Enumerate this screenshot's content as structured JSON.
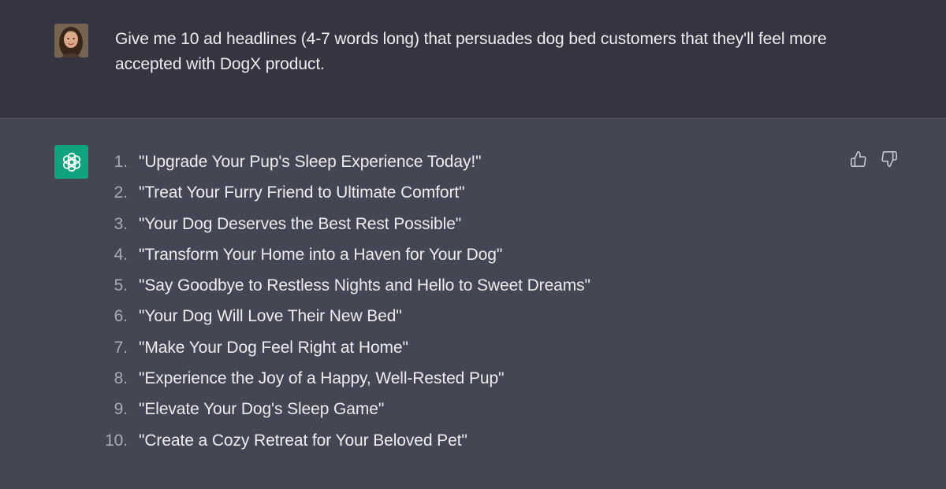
{
  "user": {
    "avatar_icon": "user-avatar",
    "message": "Give me 10 ad headlines (4-7 words long) that persuades dog bed customers that they'll feel more accepted with DogX product."
  },
  "assistant": {
    "logo_icon": "openai-logo-icon",
    "logo_color": "#10a37f",
    "headlines": [
      {
        "num": "1.",
        "text": "\"Upgrade Your Pup's Sleep Experience Today!\""
      },
      {
        "num": "2.",
        "text": "\"Treat Your Furry Friend to Ultimate Comfort\""
      },
      {
        "num": "3.",
        "text": "\"Your Dog Deserves the Best Rest Possible\""
      },
      {
        "num": "4.",
        "text": "\"Transform Your Home into a Haven for Your Dog\""
      },
      {
        "num": "5.",
        "text": "\"Say Goodbye to Restless Nights and Hello to Sweet Dreams\""
      },
      {
        "num": "6.",
        "text": "\"Your Dog Will Love Their New Bed\""
      },
      {
        "num": "7.",
        "text": "\"Make Your Dog Feel Right at Home\""
      },
      {
        "num": "8.",
        "text": "\"Experience the Joy of a Happy, Well-Rested Pup\""
      },
      {
        "num": "9.",
        "text": "\"Elevate Your Dog's Sleep Game\""
      },
      {
        "num": "10.",
        "text": "\"Create a Cozy Retreat for Your Beloved Pet\""
      }
    ],
    "feedback": {
      "up_icon": "thumbs-up-icon",
      "down_icon": "thumbs-down-icon"
    }
  },
  "colors": {
    "user_bg": "#343541",
    "assistant_bg": "#444654",
    "text": "#ececf1",
    "number_text": "#a9abb6"
  }
}
